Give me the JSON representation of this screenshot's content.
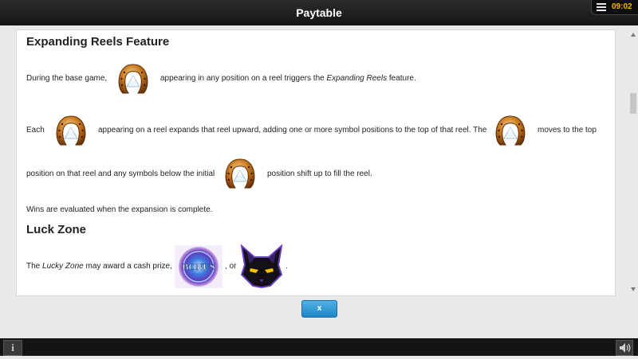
{
  "header": {
    "title": "Paytable",
    "clock": "09:02"
  },
  "content": {
    "expanding": {
      "heading": "Expanding Reels Feature",
      "p1_before": "During the base game,",
      "p1_after_plain": "appearing in any position on a reel triggers the ",
      "p1_feature": "Expanding Reels",
      "p1_end": " feature.",
      "p2_before": "Each",
      "p2_mid": "appearing on a reel expands that reel upward, adding one or more symbol positions to the top of that reel. The",
      "p2_after": "moves to the top",
      "p3_before": "position on that reel and any symbols below the initial",
      "p3_after": "position shift up to fill the reel.",
      "p4": "Wins are evaluated when the expansion is complete."
    },
    "luck": {
      "heading": "Luck Zone",
      "p_the": "The ",
      "p_zone": "Lucky Zone",
      "p_rest": " may award a cash prize,",
      "p_or": ", or",
      "p_end": ".",
      "bonus_symbol_text": "BONUS"
    }
  },
  "footer": {
    "close_label": "x"
  },
  "icons": {
    "horseshoe": "horseshoe-symbol-icon",
    "bonus": "bonus-symbol-icon",
    "cat": "cat-symbol-icon",
    "info": "info-icon",
    "sound": "speaker-icon",
    "menu": "hamburger-menu-icon"
  }
}
